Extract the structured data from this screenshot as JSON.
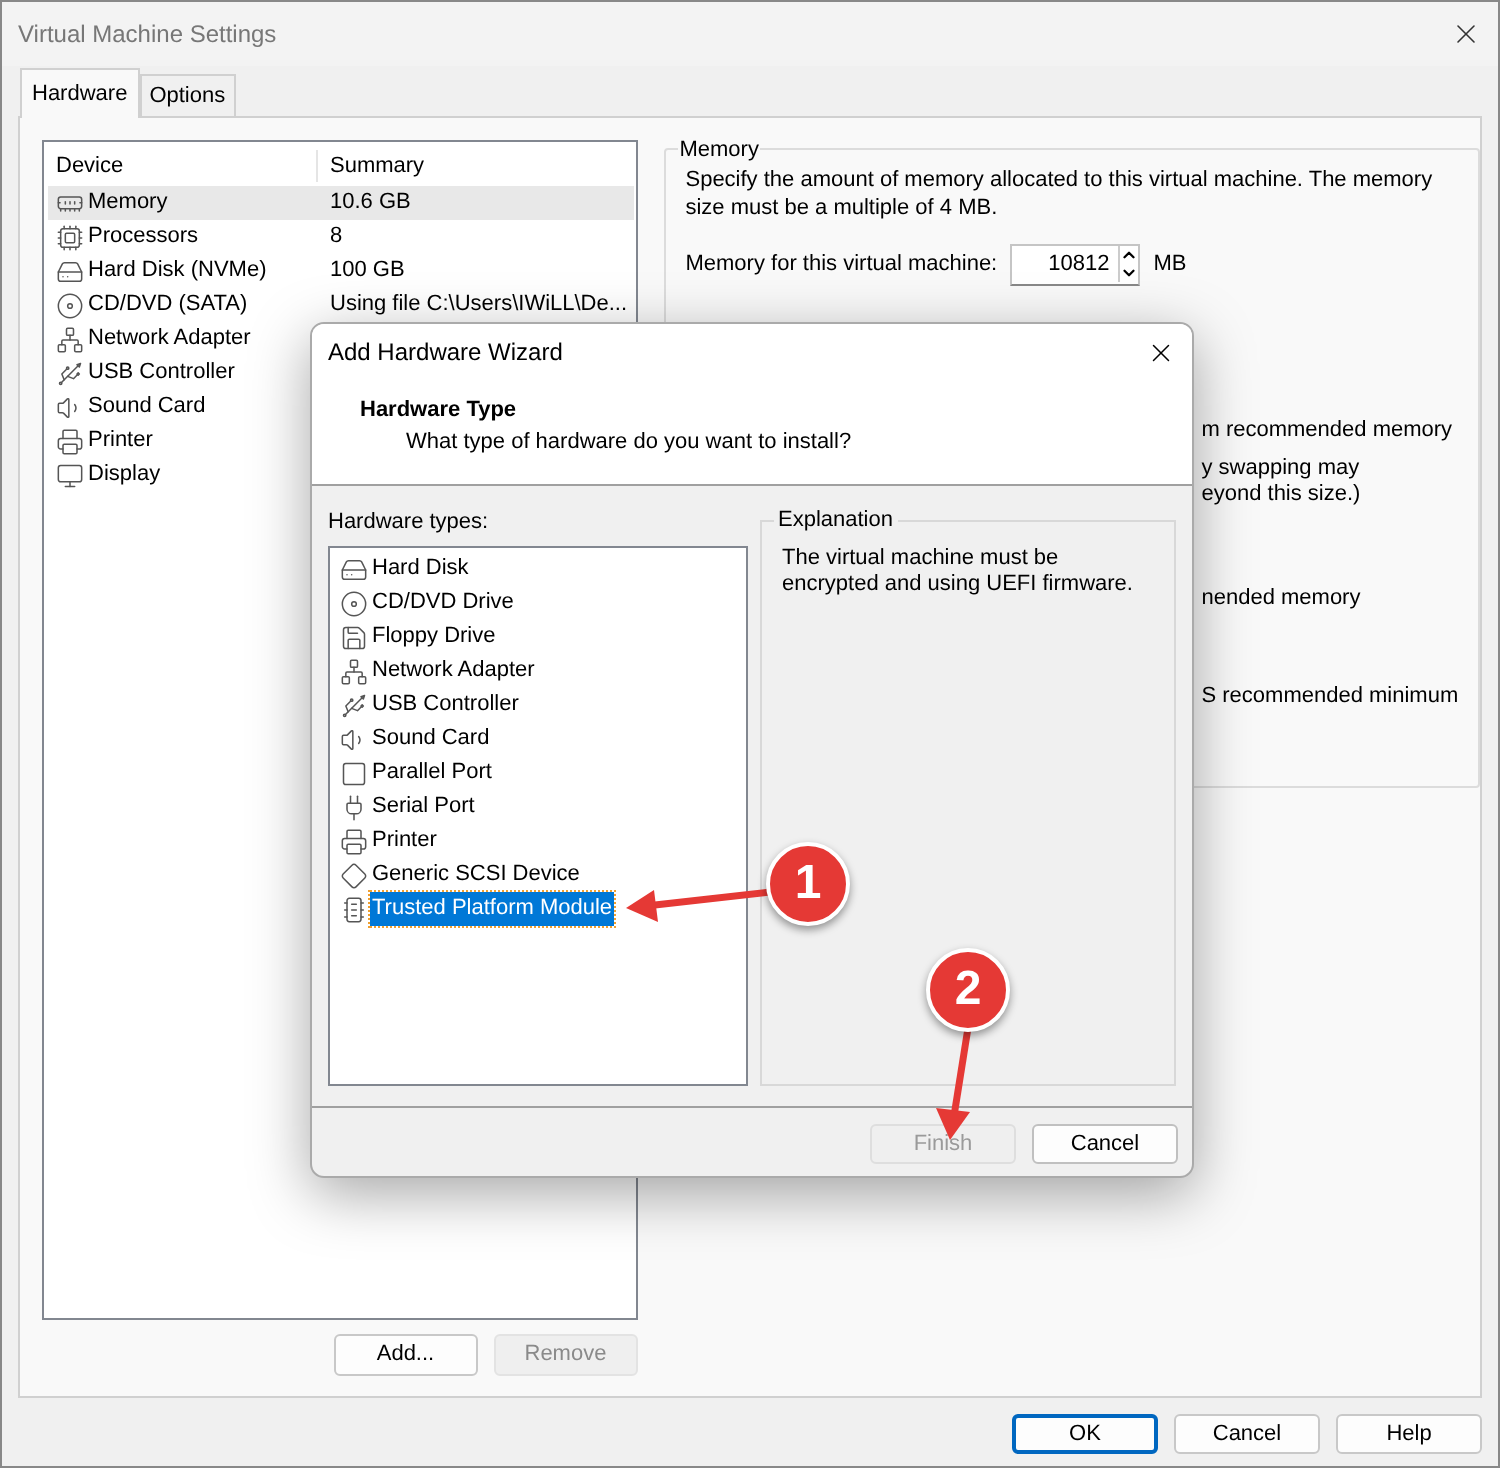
{
  "window": {
    "title": "Virtual Machine Settings"
  },
  "tabs": [
    {
      "label": "Hardware",
      "selected": true
    },
    {
      "label": "Options",
      "selected": false
    }
  ],
  "device_table": {
    "columns": [
      "Device",
      "Summary"
    ],
    "rows": [
      {
        "kind": "memory",
        "device": "Memory",
        "summary": "10.6 GB",
        "selected": true
      },
      {
        "kind": "cpu",
        "device": "Processors",
        "summary": "8",
        "selected": false
      },
      {
        "kind": "disk",
        "device": "Hard Disk (NVMe)",
        "summary": "100 GB",
        "selected": false
      },
      {
        "kind": "disc",
        "device": "CD/DVD (SATA)",
        "summary": "Using file C:\\Users\\IWiLL\\De...",
        "selected": false
      },
      {
        "kind": "network",
        "device": "Network Adapter",
        "summary": "",
        "selected": false
      },
      {
        "kind": "usb",
        "device": "USB Controller",
        "summary": "",
        "selected": false
      },
      {
        "kind": "sound",
        "device": "Sound Card",
        "summary": "",
        "selected": false
      },
      {
        "kind": "printer",
        "device": "Printer",
        "summary": "",
        "selected": false
      },
      {
        "kind": "display",
        "device": "Display",
        "summary": "",
        "selected": false
      }
    ]
  },
  "device_buttons": [
    {
      "label": "Add...",
      "disabled": false
    },
    {
      "label": "Remove",
      "disabled": true
    }
  ],
  "memory_group": {
    "legend": "Memory",
    "description": "Specify the amount of memory allocated to this virtual machine. The memory size must be a multiple of 4 MB.",
    "field_label": "Memory for this virtual machine:",
    "value": "10812",
    "unit": "MB",
    "partly_hidden_lines": [
      "m recommended memory",
      "y swapping may",
      "eyond this size.)",
      "nended memory",
      "S recommended minimum"
    ]
  },
  "dialog_buttons": [
    {
      "label": "OK",
      "default": true
    },
    {
      "label": "Cancel",
      "default": false
    },
    {
      "label": "Help",
      "default": false
    }
  ],
  "wizard": {
    "title": "Add Hardware Wizard",
    "heading": "Hardware Type",
    "subtitle": "What type of hardware do you want to install?",
    "list_label": "Hardware types:",
    "hardware_types": [
      {
        "kind": "disk",
        "label": "Hard Disk",
        "selected": false
      },
      {
        "kind": "disc",
        "label": "CD/DVD Drive",
        "selected": false
      },
      {
        "kind": "floppy",
        "label": "Floppy Drive",
        "selected": false
      },
      {
        "kind": "network",
        "label": "Network Adapter",
        "selected": false
      },
      {
        "kind": "usb",
        "label": "USB Controller",
        "selected": false
      },
      {
        "kind": "sound",
        "label": "Sound Card",
        "selected": false
      },
      {
        "kind": "parallel",
        "label": "Parallel Port",
        "selected": false
      },
      {
        "kind": "serial",
        "label": "Serial Port",
        "selected": false
      },
      {
        "kind": "printer",
        "label": "Printer",
        "selected": false
      },
      {
        "kind": "scsi",
        "label": "Generic SCSI Device",
        "selected": false
      },
      {
        "kind": "tpm",
        "label": "Trusted Platform Module",
        "selected": true
      }
    ],
    "explanation": {
      "legend": "Explanation",
      "text": "The virtual machine must be encrypted and using UEFI firmware."
    },
    "buttons": [
      {
        "label": "Finish",
        "disabled": true
      },
      {
        "label": "Cancel",
        "disabled": false
      }
    ]
  },
  "callouts": [
    {
      "label": "1"
    },
    {
      "label": "2"
    }
  ]
}
